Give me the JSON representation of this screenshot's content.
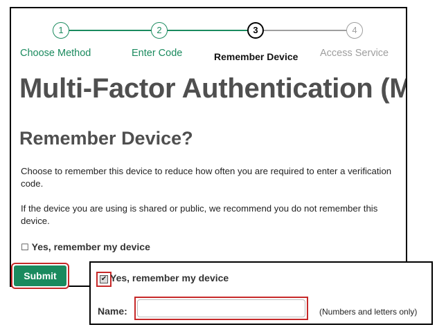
{
  "stepper": {
    "steps": [
      {
        "number": "1",
        "label": "Choose Method",
        "state": "done"
      },
      {
        "number": "2",
        "label": "Enter Code",
        "state": "done"
      },
      {
        "number": "3",
        "label": "Remember Device",
        "state": "current"
      },
      {
        "number": "4",
        "label": "Access Service",
        "state": "pending"
      }
    ]
  },
  "main": {
    "title": "Multi-Factor Authentication (MFA)",
    "section_title": "Remember Device?",
    "paragraph_1": "Choose to remember this device to reduce how often you are required to enter a verification code.",
    "paragraph_2": "If the device you are using is shared or public, we recommend you do not remember this device.",
    "remember_checkbox": {
      "label": "Yes, remember my device",
      "checked": false
    },
    "submit_label": "Submit"
  },
  "overlay": {
    "remember_checkbox": {
      "label": "Yes, remember my device",
      "checked": true
    },
    "name_label": "Name:",
    "name_value": "",
    "name_hint": "(Numbers and letters only)"
  },
  "colors": {
    "accent_green": "#1a8a5e",
    "highlight_red": "#c62828",
    "heading_gray": "#4f4f4f",
    "pending_gray": "#9e9e9e"
  }
}
